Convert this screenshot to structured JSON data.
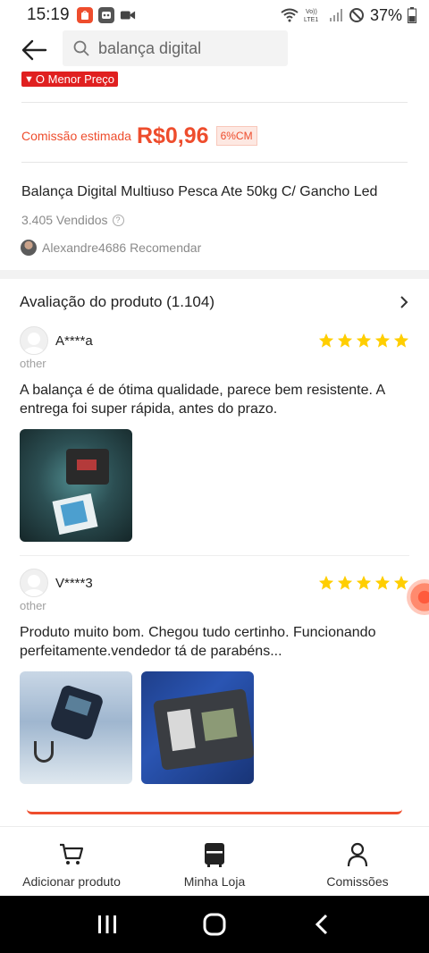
{
  "status_bar": {
    "time": "15:19",
    "battery": "37%"
  },
  "search": {
    "query": "balança digital"
  },
  "product": {
    "lowest_price_badge": "O Menor Preço",
    "commission_label": "Comissão estimada",
    "commission_value": "R$0,96",
    "commission_percent": "6%CM",
    "title": "Balança Digital Multiuso Pesca Ate 50kg C/ Gancho Led",
    "sold": "3.405 Vendidos",
    "recommender": "Alexandre4686 Recomendar"
  },
  "reviews": {
    "title": "Avaliação do produto (1.104)",
    "items": [
      {
        "user": "A****a",
        "variant": "other",
        "rating": 5,
        "text": "A balança é de ótima qualidade, parece bem resistente. A entrega foi super rápida, antes do prazo."
      },
      {
        "user": "V****3",
        "variant": "other",
        "rating": 5,
        "text": "Produto muito bom. Chegou tudo certinho. Funcionando perfeitamente.vendedor tá de parabéns..."
      }
    ]
  },
  "bottom_nav": {
    "add_product": "Adicionar produto",
    "my_store": "Minha Loja",
    "commissions": "Comissões"
  },
  "colors": {
    "accent": "#ee4d2d",
    "badge_red": "#e02020",
    "star": "#ffce00"
  }
}
